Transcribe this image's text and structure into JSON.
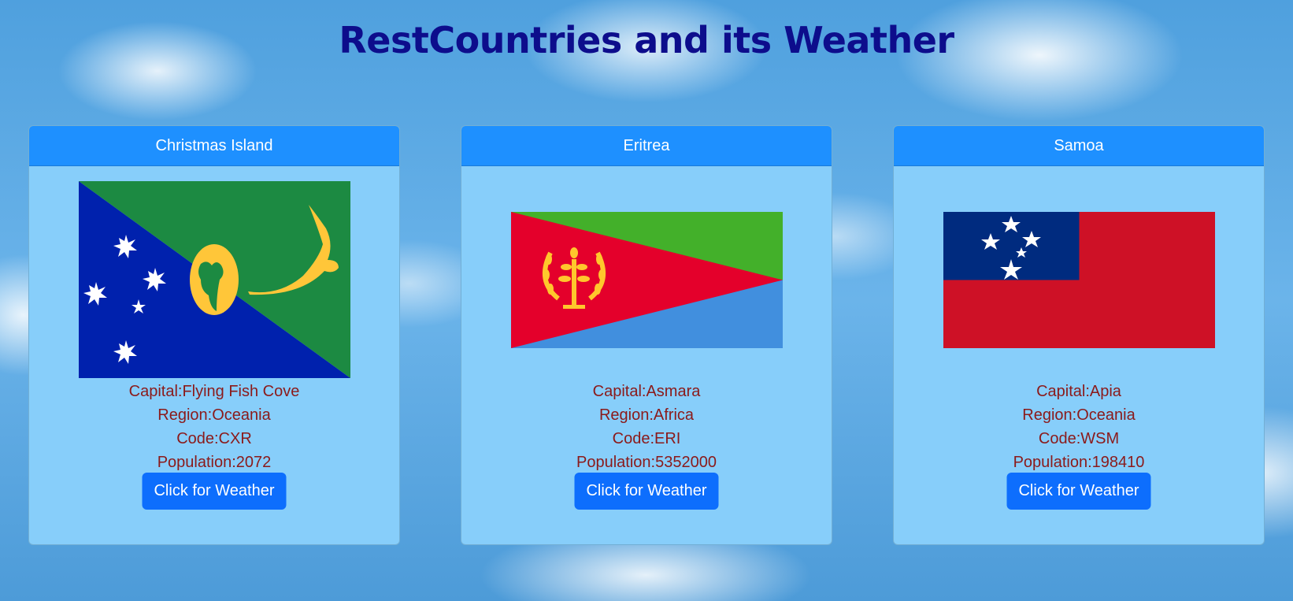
{
  "page": {
    "title": "RestCountries and its Weather"
  },
  "colors": {
    "title": "#0d0d8c",
    "card_body": "#87cefa",
    "card_header": "#1e90ff",
    "info_text": "#8b1a1a",
    "button": "#0d6efd"
  },
  "cards": [
    {
      "name": "Christmas Island",
      "flag": "christmas-island-flag",
      "capital": "Capital:Flying Fish Cove",
      "region": "Region:Oceania",
      "code": "Code:CXR",
      "population": "Population:2072",
      "button_label": "Click for Weather"
    },
    {
      "name": "Eritrea",
      "flag": "eritrea-flag",
      "capital": "Capital:Asmara",
      "region": "Region:Africa",
      "code": "Code:ERI",
      "population": "Population:5352000",
      "button_label": "Click for Weather"
    },
    {
      "name": "Samoa",
      "flag": "samoa-flag",
      "capital": "Capital:Apia",
      "region": "Region:Oceania",
      "code": "Code:WSM",
      "population": "Population:198410",
      "button_label": "Click for Weather"
    }
  ]
}
